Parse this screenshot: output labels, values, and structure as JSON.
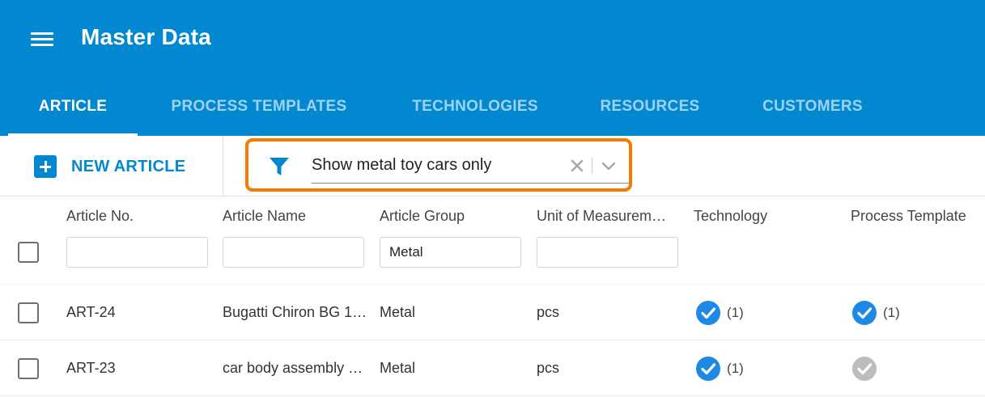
{
  "app": {
    "title": "Master Data"
  },
  "tabs": [
    {
      "label": "ARTICLE",
      "active": true
    },
    {
      "label": "PROCESS TEMPLATES",
      "active": false
    },
    {
      "label": "TECHNOLOGIES",
      "active": false
    },
    {
      "label": "RESOURCES",
      "active": false
    },
    {
      "label": "CUSTOMERS",
      "active": false
    }
  ],
  "toolbar": {
    "new_label": "NEW ARTICLE",
    "filter_value": "Show metal toy cars only"
  },
  "grid": {
    "columns": [
      {
        "title": "Article No.",
        "filter": ""
      },
      {
        "title": "Article Name",
        "filter": ""
      },
      {
        "title": "Article Group",
        "filter": "Metal"
      },
      {
        "title": "Unit of Measurem…",
        "filter": ""
      },
      {
        "title": "Technology"
      },
      {
        "title": "Process Template"
      }
    ],
    "rows": [
      {
        "no": "ART-24",
        "name": "Bugatti Chiron BG 1:…",
        "group": "Metal",
        "unit": "pcs",
        "tech_count": "(1)",
        "tech_checked": true,
        "proc_count": "(1)",
        "proc_checked": true
      },
      {
        "no": "ART-23",
        "name": "car body assembly …",
        "group": "Metal",
        "unit": "pcs",
        "tech_count": "(1)",
        "tech_checked": true,
        "proc_count": "",
        "proc_checked": false
      }
    ]
  },
  "colors": {
    "primary": "#0288d1",
    "highlight": "#f57c00",
    "check_active": "#1e88e5",
    "check_inactive": "#bdbdbd"
  }
}
